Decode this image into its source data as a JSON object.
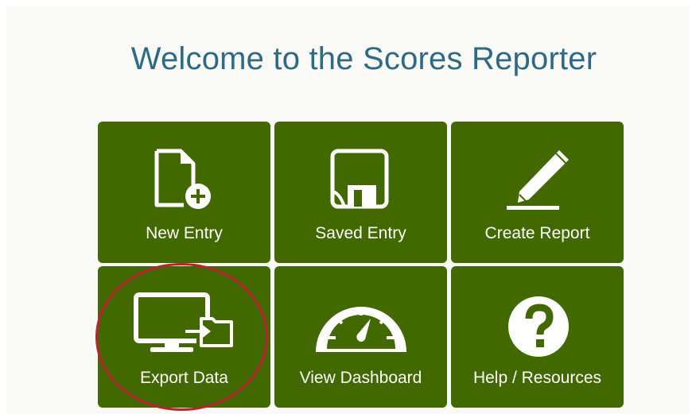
{
  "page": {
    "title": "Welcome to the Scores Reporter"
  },
  "tiles": [
    {
      "label": "New Entry",
      "icon": "new-document-icon"
    },
    {
      "label": "Saved Entry",
      "icon": "save-disk-icon"
    },
    {
      "label": "Create Report",
      "icon": "pencil-icon"
    },
    {
      "label": "Export Data",
      "icon": "export-monitor-icon"
    },
    {
      "label": "View Dashboard",
      "icon": "speedometer-icon"
    },
    {
      "label": "Help / Resources",
      "icon": "question-circle-icon"
    }
  ],
  "colors": {
    "tile_background": "#426800",
    "title_text": "#2e6a86",
    "highlight_circle": "#b8232f",
    "panel_background": "#f9f9f5"
  }
}
